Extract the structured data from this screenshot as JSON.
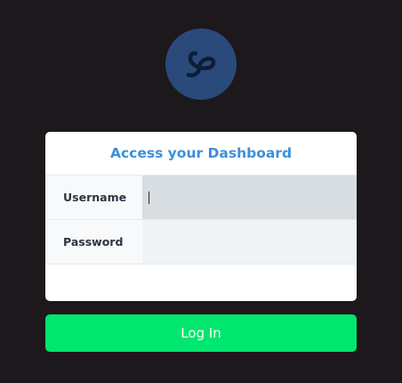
{
  "logo": {
    "icon": "curl-logo-icon",
    "background": "#294a7a",
    "stroke": "#0d1d36"
  },
  "card": {
    "title": "Access your Dashboard",
    "username": {
      "label": "Username",
      "value": "",
      "placeholder": ""
    },
    "password": {
      "label": "Password",
      "value": "",
      "placeholder": ""
    }
  },
  "login_button": {
    "label": "Log In",
    "color": "#00e66e"
  },
  "colors": {
    "page_background": "#1c181b",
    "title": "#3d8fd9"
  }
}
